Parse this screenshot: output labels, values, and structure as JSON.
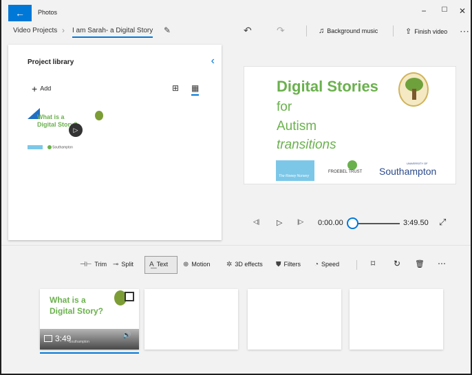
{
  "titlebar": {
    "app_title": "Photos",
    "back_icon": "←",
    "minimize_icon": "−",
    "maximize_icon": "☐",
    "close_icon": "✕"
  },
  "toolbar": {
    "breadcrumb_root": "Video Projects",
    "breadcrumb_sep": "›",
    "project_name": "I am Sarah- a Digital Story",
    "rename_icon": "✎",
    "undo_icon": "↶",
    "redo_icon": "↷",
    "music_icon": "♫",
    "music_label": "Background music",
    "finish_icon": "⇪",
    "finish_label": "Finish video",
    "more_icon": "⋯"
  },
  "library": {
    "title": "Project library",
    "collapse_icon": "‹",
    "add_icon": "+",
    "add_label": "Add",
    "view_grid_icon": "⊞",
    "view_list_icon": "▦",
    "thumb_text": "What is a Digital Story?",
    "thumb_play_icon": "▷",
    "thumb_logos": "Southampton"
  },
  "preview": {
    "title": "Digital Stories",
    "line1": "for",
    "line2": "Autism",
    "line3": "transitions",
    "logo1_text": "The Rowey Nursery",
    "logo2_text": "FROEBEL TRUST",
    "logo3_top": "UNIVERSITY OF",
    "logo3_text": "Southampton"
  },
  "playback": {
    "rewind_icon": "◁|",
    "play_icon": "▷",
    "forward_icon": "|▷",
    "current_time": "0:00.00",
    "total_time": "3:49.50",
    "expand_icon": "⤢",
    "position": 0
  },
  "edit_toolbar": {
    "trim_icon": "⊣⊢",
    "trim_label": "Trim",
    "split_icon": "⊸",
    "split_label": "Split",
    "text_icon": "A͟",
    "text_label": "Text",
    "motion_icon": "⊕",
    "motion_label": "Motion",
    "effects_icon": "✲",
    "effects_label": "3D effects",
    "filters_icon": "⛊",
    "filters_label": "Filters",
    "speed_icon": "◔",
    "speed_label": "Speed",
    "resize_icon": "⌑",
    "rotate_icon": "↻",
    "delete_icon": "🗑",
    "more_icon": "⋯"
  },
  "storyboard": {
    "card1_title": "What is a Digital Story?",
    "card1_duration": "3:49",
    "card1_logos": "Southampton",
    "card1_volume_icon": "🔊"
  }
}
